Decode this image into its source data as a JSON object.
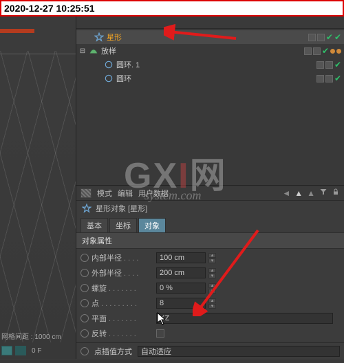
{
  "timestamp": "2020-12-27 10:25:51",
  "viewport": {
    "grid_label": "网格间距 : 1000 cm",
    "frame_indicator": "0  F"
  },
  "object_tree": {
    "items": [
      {
        "label": "星形",
        "highlight": true,
        "icon": "star",
        "indent": 0,
        "checks": 2,
        "tags": 0,
        "expander": ""
      },
      {
        "label": "放样",
        "highlight": false,
        "icon": "loft",
        "indent": 0,
        "checks": 1,
        "tags": 2,
        "expander": "⊟"
      },
      {
        "label": "圆环. 1",
        "highlight": false,
        "icon": "circle",
        "indent": 1,
        "checks": 1,
        "tags": 0,
        "expander": ""
      },
      {
        "label": "圆环",
        "highlight": false,
        "icon": "circle",
        "indent": 1,
        "checks": 1,
        "tags": 0,
        "expander": ""
      }
    ]
  },
  "attributes": {
    "menu": {
      "mode": "模式",
      "edit": "编辑",
      "userdata": "用户数据"
    },
    "title": "星形对象 [星形]",
    "tabs": {
      "basic": "基本",
      "coord": "坐标",
      "object": "对象"
    },
    "section": "对象属性",
    "rows": {
      "inner_radius": {
        "label": "内部半径",
        "value": "100 cm"
      },
      "outer_radius": {
        "label": "外部半径",
        "value": "200 cm"
      },
      "twist": {
        "label": "螺旋",
        "value": "0 %"
      },
      "points": {
        "label": "点",
        "value": "8"
      },
      "plane": {
        "label": "平面",
        "value": "XZ"
      },
      "reverse": {
        "label": "反转"
      }
    }
  },
  "footer": {
    "interp_label": "点插值方式",
    "interp_value": "自动适应"
  },
  "watermark": {
    "line1a": "GX",
    "line1b": "I",
    "line1c": "网",
    "line2": "system.com"
  },
  "dots": ". . . . . ."
}
